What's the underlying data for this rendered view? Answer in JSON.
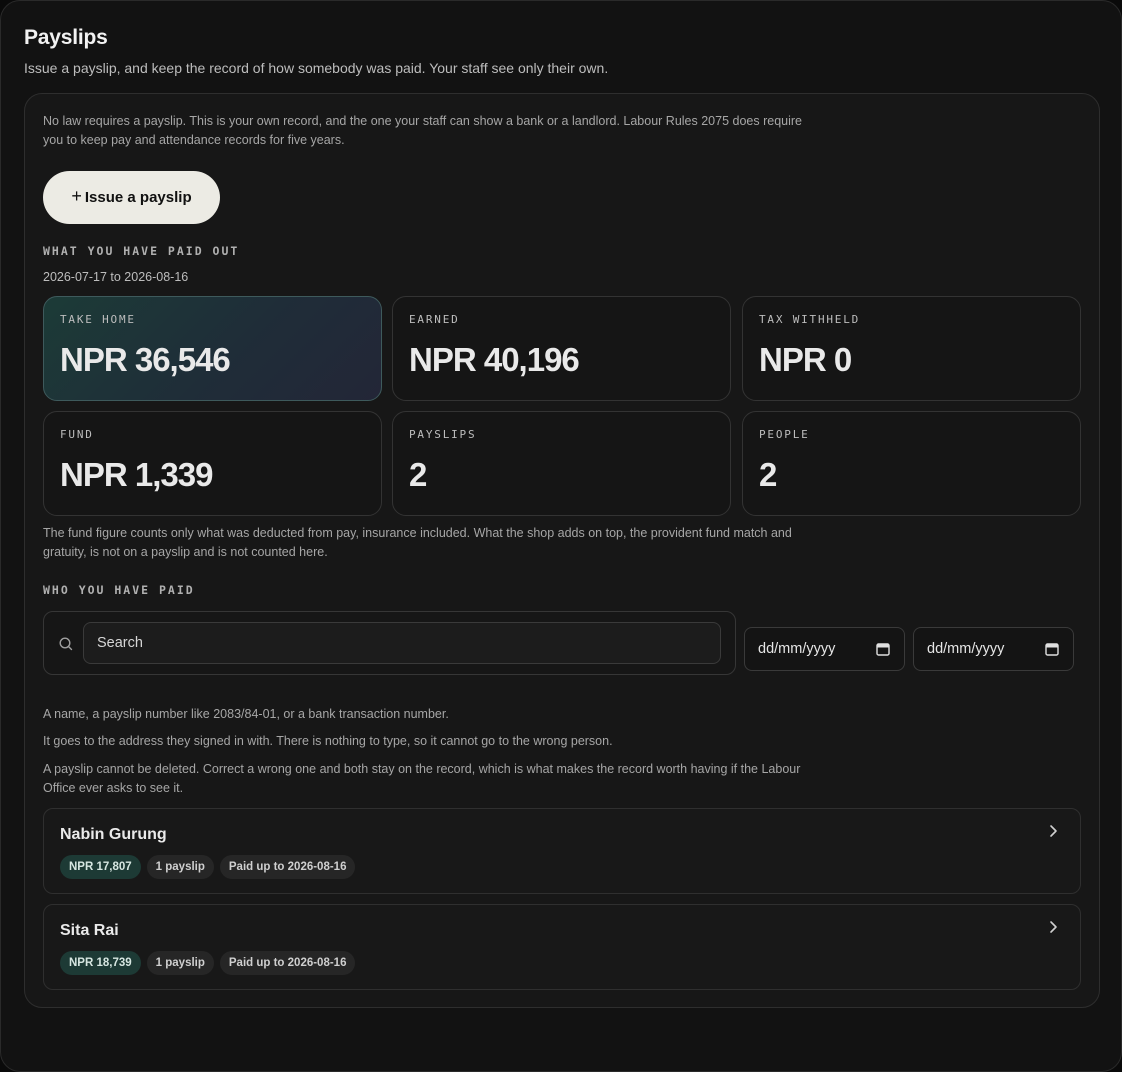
{
  "header": {
    "title": "Payslips",
    "subtitle": "Issue a payslip, and keep the record of how somebody was paid. Your staff see only their own."
  },
  "panel": {
    "intro": "No law requires a payslip. This is your own record, and the one your staff can show a bank or a landlord. Labour Rules 2075 does require you to keep pay and attendance records for five years.",
    "issue_button": {
      "icon": "+",
      "label": "Issue a payslip"
    },
    "paid_out": {
      "label": "WHAT YOU HAVE PAID OUT",
      "range": "2026-07-17 to 2026-08-16",
      "cards": [
        {
          "label": "TAKE HOME",
          "value": "NPR 36,546"
        },
        {
          "label": "EARNED",
          "value": "NPR 40,196"
        },
        {
          "label": "TAX WITHHELD",
          "value": "NPR 0"
        },
        {
          "label": "FUND",
          "value": "NPR 1,339"
        },
        {
          "label": "PAYSLIPS",
          "value": "2"
        },
        {
          "label": "PEOPLE",
          "value": "2"
        }
      ],
      "fund_note": "The fund figure counts only what was deducted from pay, insurance included. What the shop adds on top, the provident fund match and gratuity, is not on a payslip and is not counted here."
    },
    "who_paid": {
      "label": "WHO YOU HAVE PAID",
      "search": {
        "placeholder": "Search",
        "value": ""
      },
      "date_from": {
        "placeholder": "dd/mm/yyyy"
      },
      "date_to": {
        "placeholder": "dd/mm/yyyy"
      },
      "hints": [
        "A name, a payslip number like 2083/84-01, or a bank transaction number.",
        "It goes to the address they signed in with. There is nothing to type, so it cannot go to the wrong person.",
        "A payslip cannot be deleted. Correct a wrong one and both stay on the record, which is what makes the record worth having if the Labour Office ever asks to see it."
      ],
      "people": [
        {
          "name": "Nabin Gurung",
          "amount": "NPR 17,807",
          "count": "1 payslip",
          "paid_up_to": "Paid up to 2026-08-16"
        },
        {
          "name": "Sita Rai",
          "amount": "NPR 18,739",
          "count": "1 payslip",
          "paid_up_to": "Paid up to 2026-08-16"
        }
      ]
    }
  },
  "colors": {
    "accent_chip": "#1d3a35",
    "button_bg": "#ecebe4",
    "background": "#121212"
  },
  "icons": {
    "search": "search-icon",
    "calendar": "calendar-icon",
    "row_open": "chevron-right-icon",
    "add": "plus-icon"
  }
}
